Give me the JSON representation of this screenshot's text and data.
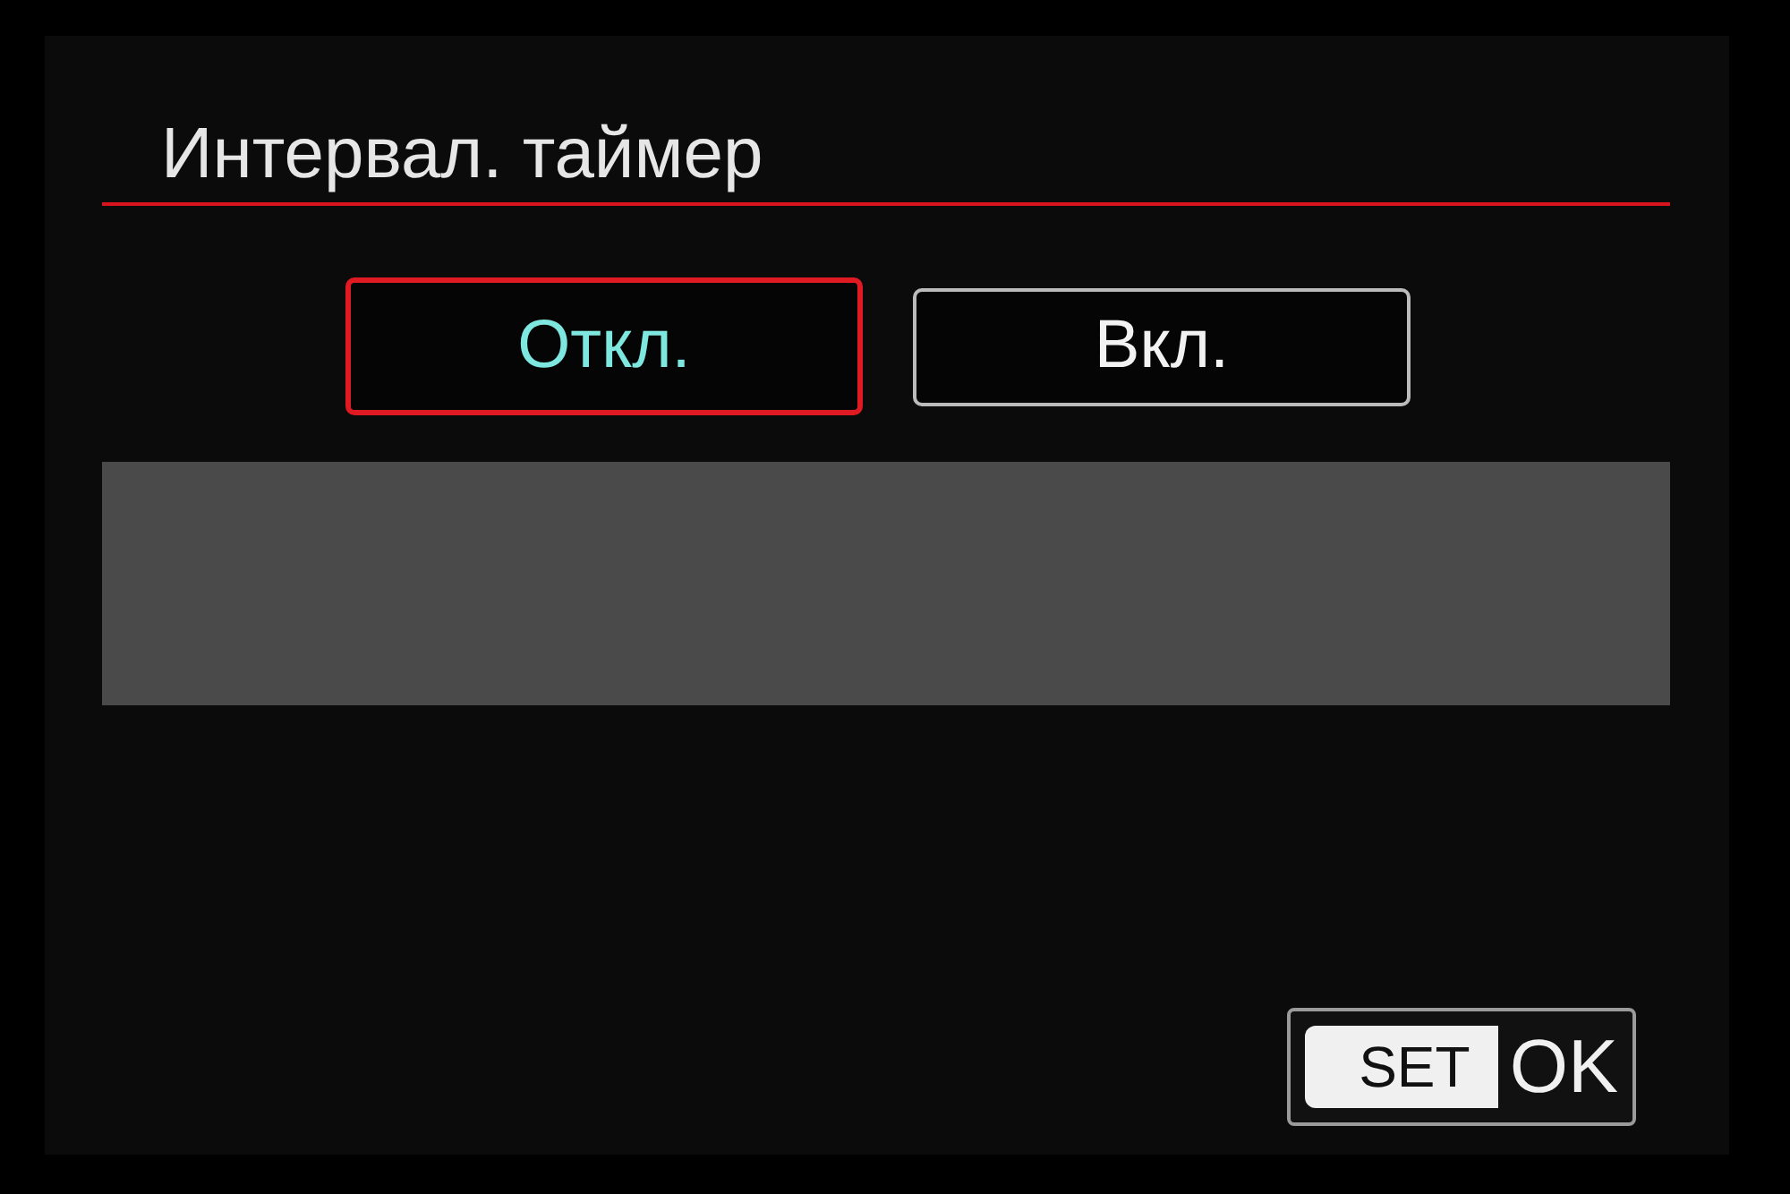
{
  "screen": {
    "title": "Интервал. таймер"
  },
  "options": [
    {
      "label": "Откл.",
      "selected": true
    },
    {
      "label": "Вкл.",
      "selected": false
    }
  ],
  "confirm_button": {
    "key": "SET",
    "label": "OK"
  }
}
